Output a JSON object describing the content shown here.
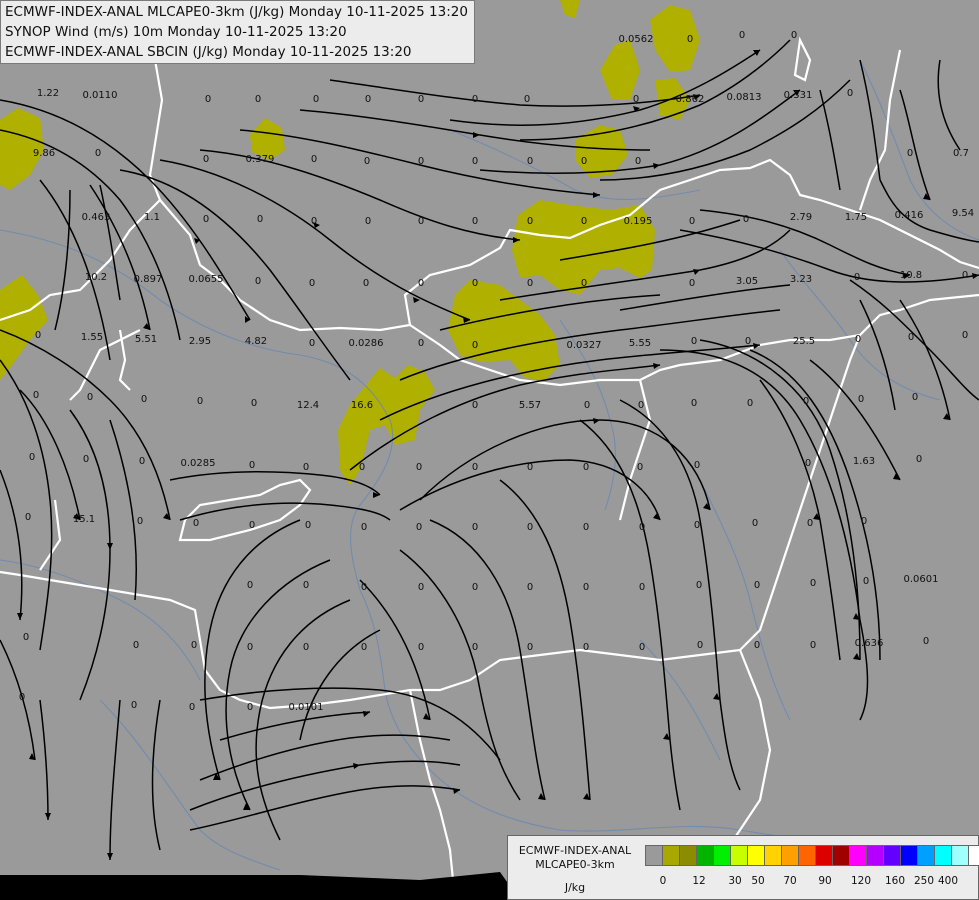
{
  "titles": {
    "line1": "ECMWF-INDEX-ANAL MLCAPE0-3km (J/kg) Monday 10-11-2025 13:20",
    "line2": "SYNOP Wind (m/s) 10m Monday 10-11-2025 13:20",
    "line3": "ECMWF-INDEX-ANAL SBCIN (J/kg) Monday 10-11-2025 13:20"
  },
  "legend": {
    "title_line1": "ECMWF-INDEX-ANAL",
    "title_line2": "MLCAPE0-3km",
    "unit": "J/kg",
    "colors": [
      "#9a9a9a",
      "#a8a800",
      "#8c8c00",
      "#00b400",
      "#00f000",
      "#c8ff00",
      "#ffff00",
      "#ffd200",
      "#ffa000",
      "#ff6400",
      "#dc0000",
      "#a00000",
      "#ff00ff",
      "#b400ff",
      "#6400ff",
      "#0000ff",
      "#00a0ff",
      "#00ffff",
      "#a0ffff",
      "#ffffff"
    ],
    "ticks": [
      "0",
      "12",
      "30",
      "50",
      "70",
      "90",
      "120",
      "160",
      "250",
      "400"
    ]
  },
  "colors": {
    "cape_fill": "#b0b000",
    "background": "#9a9a9a",
    "border": "#ffffff",
    "river": "#6f8ab0"
  },
  "sbcin_values": [
    "1.22",
    "0.0110",
    "0",
    "0",
    "0",
    "0",
    "0",
    "0",
    "0",
    "0.0562",
    "0",
    "0",
    "0",
    "9.86",
    "0",
    "0",
    "0.379",
    "0",
    "0",
    "0",
    "0",
    "0",
    "0",
    "0",
    "0",
    "0.862",
    "0.0813",
    "0.331",
    "0",
    "0",
    "0.7",
    "0.463",
    "1.1",
    "0",
    "0",
    "0",
    "0",
    "0",
    "0",
    "0",
    "0",
    "0.195",
    "0",
    "0",
    "2.79",
    "1.75",
    "0.416",
    "9.54",
    "10.2",
    "0.897",
    "0.0655",
    "0",
    "0",
    "0",
    "0",
    "0",
    "0",
    "0",
    "0",
    "3.05",
    "3.23",
    "0",
    "10.8",
    "0",
    "0",
    "1.55",
    "5.51",
    "2.95",
    "4.82",
    "0",
    "0.0286",
    "0",
    "0",
    "0.0327",
    "5.55",
    "0",
    "0",
    "25.5",
    "0",
    "0",
    "0",
    "0",
    "0",
    "0",
    "0",
    "0",
    "12.4",
    "16.6",
    "0",
    "5.57",
    "0",
    "0",
    "0",
    "0",
    "0",
    "0",
    "0",
    "0",
    "0",
    "0",
    "0.0285",
    "0",
    "0",
    "0",
    "0",
    "0",
    "0",
    "0",
    "0",
    "0",
    "0",
    "1.63",
    "0",
    "0",
    "15.1",
    "0",
    "0",
    "0",
    "0",
    "0",
    "0",
    "0",
    "0",
    "0",
    "0",
    "0",
    "0",
    "0",
    "0",
    "0.0601",
    "0",
    "0",
    "0",
    "0",
    "0",
    "0",
    "0",
    "0",
    "0",
    "0",
    "0",
    "0",
    "0",
    "0",
    "0",
    "0",
    "0",
    "0",
    "0",
    "0",
    "0",
    "0",
    "0",
    "0",
    "0",
    "0",
    "0.636",
    "0",
    "0",
    "0",
    "0",
    "0",
    "0.0101"
  ]
}
